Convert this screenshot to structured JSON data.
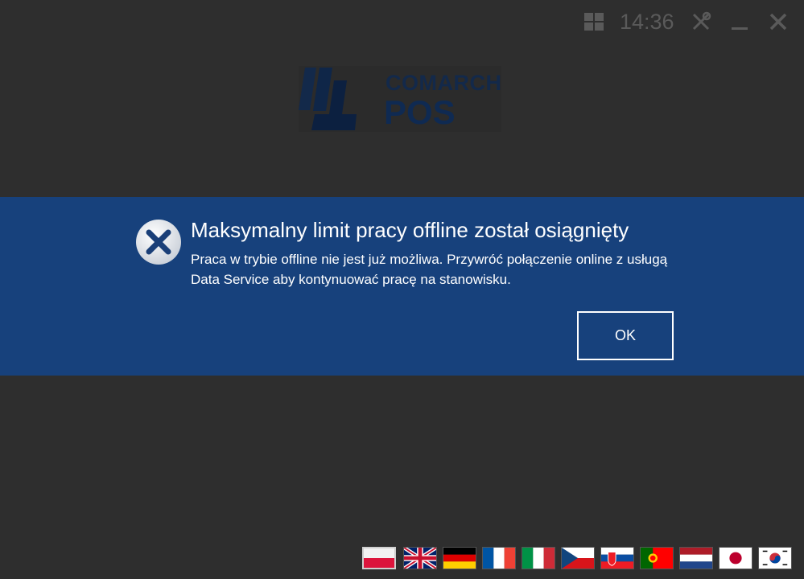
{
  "topbar": {
    "clock": "14:36",
    "icons": [
      "windows-icon",
      "tools-icon",
      "minimize-icon",
      "close-icon"
    ]
  },
  "logo": {
    "brand": "COMARCH",
    "product": "POS"
  },
  "dialog": {
    "title": "Maksymalny limit pracy offline został osiągnięty",
    "message": "Praca w trybie offline nie jest już możliwa. Przywróć połączenie online z usługą Data Service aby kontynuować pracę na stanowisku.",
    "ok_label": "OK",
    "background_color": "#17417c",
    "icon": "error-x-icon"
  },
  "languages": {
    "flags": [
      "poland",
      "united-kingdom",
      "germany",
      "france",
      "italy",
      "czech-republic",
      "slovakia",
      "portugal",
      "netherlands",
      "japan",
      "south-korea"
    ],
    "selected": "poland"
  }
}
